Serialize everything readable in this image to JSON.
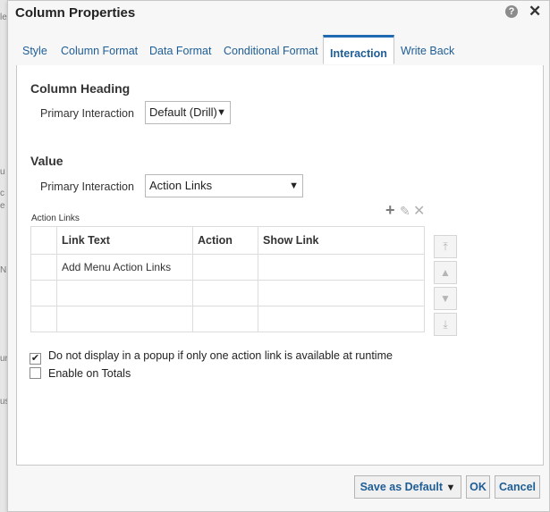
{
  "dialog": {
    "title": "Column Properties",
    "help_glyph": "?",
    "close_glyph": "✕"
  },
  "background_fragments": [
    "le",
    "u",
    "c",
    "e",
    "N",
    "ur",
    "us"
  ],
  "tabs": [
    {
      "label": "Style",
      "active": false
    },
    {
      "label": "Column Format",
      "active": false
    },
    {
      "label": "Data Format",
      "active": false
    },
    {
      "label": "Conditional Format",
      "active": false
    },
    {
      "label": "Interaction",
      "active": true
    },
    {
      "label": "Write Back",
      "active": false
    }
  ],
  "column_heading": {
    "title": "Column Heading",
    "primary_label": "Primary Interaction",
    "primary_value": "Default (Drill)"
  },
  "value": {
    "title": "Value",
    "primary_label": "Primary Interaction",
    "primary_value": "Action Links"
  },
  "action_links": {
    "label": "Action Links",
    "add_glyph": "+",
    "edit_glyph": "✎",
    "delete_glyph": "✕",
    "headers": [
      "Link Text",
      "Action",
      "Show Link"
    ],
    "rows": [
      [
        "Add Menu Action Links",
        "",
        ""
      ],
      [
        "",
        "",
        ""
      ],
      [
        "",
        "",
        ""
      ]
    ],
    "movers": [
      "⤒",
      "▲",
      "▼",
      "⤓"
    ]
  },
  "options": {
    "no_popup": {
      "label": "Do not display in a popup if only one action link is available at runtime",
      "checked": true,
      "mark": "✔"
    },
    "enable_totals": {
      "label": "Enable on Totals",
      "checked": false
    }
  },
  "footer": {
    "save_default": "Save as Default",
    "ok": "OK",
    "cancel": "Cancel"
  },
  "colors": {
    "link_blue": "#1e5d95",
    "active_tab_border": "#1f6ab0"
  }
}
